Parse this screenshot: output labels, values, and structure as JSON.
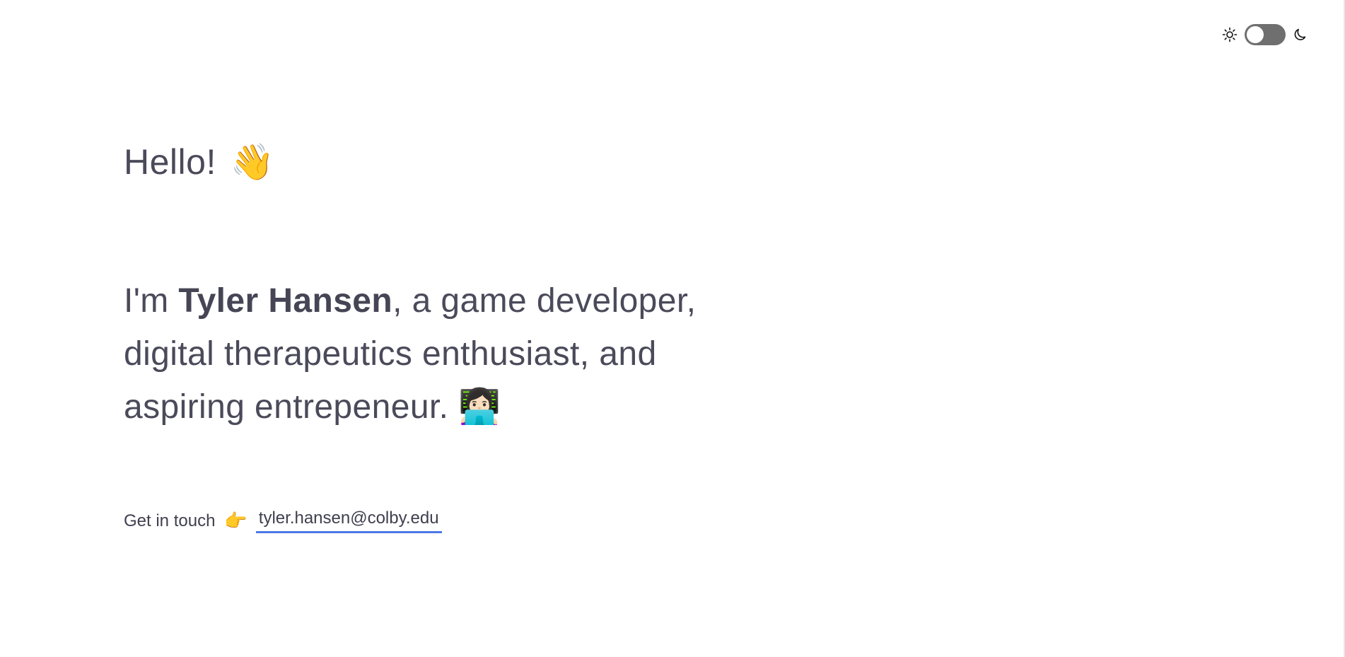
{
  "theme_switch": {
    "light_icon": "sun-icon",
    "dark_icon": "moon-icon",
    "mode": "light"
  },
  "hero": {
    "greeting": "Hello!",
    "greeting_emoji": "👋",
    "intro_prefix": "I'm ",
    "name": "Tyler Hansen",
    "intro_suffix": ", a game developer, digital therapeutics enthusiast, and aspiring entrepeneur.",
    "intro_emoji": "👩🏻‍💻"
  },
  "contact": {
    "label": "Get in touch",
    "pointer_emoji": "👉",
    "email": "tyler.hansen@colby.edu"
  },
  "colors": {
    "text": "#4a4a5a",
    "link_underline": "#4d79e5",
    "toggle_track": "#6f6f6f",
    "background": "#ffffff"
  }
}
